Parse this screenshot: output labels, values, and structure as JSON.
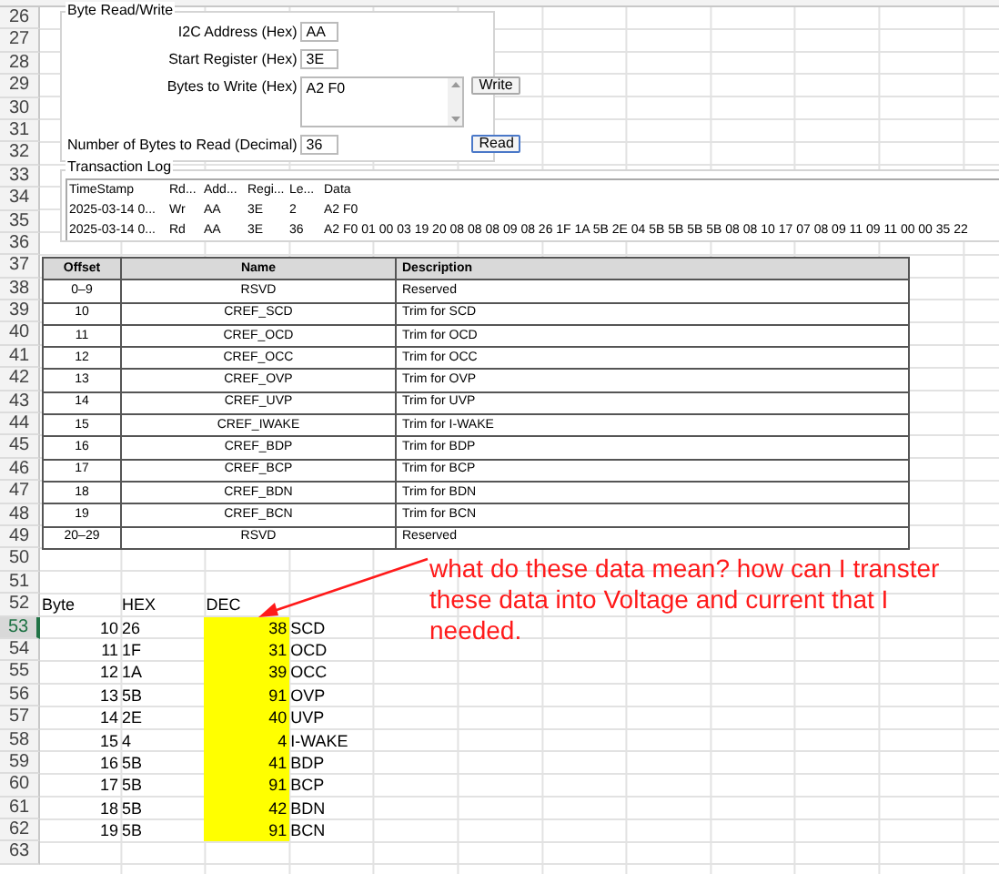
{
  "row_headers": [
    {
      "label": "26",
      "selected": false
    },
    {
      "label": "27",
      "selected": false
    },
    {
      "label": "28",
      "selected": false
    },
    {
      "label": "29",
      "selected": false
    },
    {
      "label": "30",
      "selected": false
    },
    {
      "label": "31",
      "selected": false
    },
    {
      "label": "32",
      "selected": false
    },
    {
      "label": "33",
      "selected": false
    },
    {
      "label": "34",
      "selected": false
    },
    {
      "label": "35",
      "selected": false
    },
    {
      "label": "36",
      "selected": false
    },
    {
      "label": "37",
      "selected": false
    },
    {
      "label": "38",
      "selected": false
    },
    {
      "label": "39",
      "selected": false
    },
    {
      "label": "40",
      "selected": false
    },
    {
      "label": "41",
      "selected": false
    },
    {
      "label": "42",
      "selected": false
    },
    {
      "label": "43",
      "selected": false
    },
    {
      "label": "44",
      "selected": false
    },
    {
      "label": "45",
      "selected": false
    },
    {
      "label": "46",
      "selected": false
    },
    {
      "label": "47",
      "selected": false
    },
    {
      "label": "48",
      "selected": false
    },
    {
      "label": "49",
      "selected": false
    },
    {
      "label": "50",
      "selected": false
    },
    {
      "label": "51",
      "selected": false
    },
    {
      "label": "52",
      "selected": false
    },
    {
      "label": "53",
      "selected": true
    },
    {
      "label": "54",
      "selected": false
    },
    {
      "label": "55",
      "selected": false
    },
    {
      "label": "56",
      "selected": false
    },
    {
      "label": "57",
      "selected": false
    },
    {
      "label": "58",
      "selected": false
    },
    {
      "label": "59",
      "selected": false
    },
    {
      "label": "60",
      "selected": false
    },
    {
      "label": "61",
      "selected": false
    },
    {
      "label": "62",
      "selected": false
    },
    {
      "label": "63",
      "selected": false
    }
  ],
  "read_write_panel": {
    "title": "Byte Read/Write",
    "i2c_address": {
      "label": "I2C Address (Hex)",
      "value": "AA"
    },
    "start_register": {
      "label": "Start Register (Hex)",
      "value": "3E"
    },
    "bytes_to_write": {
      "label": "Bytes to Write (Hex)",
      "value": "A2 F0"
    },
    "write_button": "Write",
    "bytes_to_read": {
      "label": "Number of Bytes to Read (Decimal)",
      "value": "36"
    },
    "read_button": "Read"
  },
  "transaction_log": {
    "title": "Transaction Log",
    "columns": [
      "TimeStamp",
      "Rd...",
      "Add...",
      "Regi...",
      "Le...",
      "Data"
    ],
    "rows": [
      [
        "2025-03-14 0...",
        "Wr",
        "AA",
        "3E",
        "2",
        "A2 F0"
      ],
      [
        "2025-03-14 0...",
        "Rd",
        "AA",
        "3E",
        "36",
        "A2 F0 01 00 03 19 20 08 08 08 09 08 26 1F 1A 5B 2E 04 5B 5B 5B 5B 08 08 10 17 07 08 09 11 09 11 00 00 35 22"
      ]
    ]
  },
  "register_table": {
    "columns": [
      "Offset",
      "Name",
      "Description"
    ],
    "rows": [
      [
        "0–9",
        "RSVD",
        "Reserved"
      ],
      [
        "10",
        "CREF_SCD",
        "Trim for SCD"
      ],
      [
        "11",
        "CREF_OCD",
        "Trim for OCD"
      ],
      [
        "12",
        "CREF_OCC",
        "Trim for OCC"
      ],
      [
        "13",
        "CREF_OVP",
        "Trim for OVP"
      ],
      [
        "14",
        "CREF_UVP",
        "Trim for UVP"
      ],
      [
        "15",
        "CREF_IWAKE",
        "Trim for I-WAKE"
      ],
      [
        "16",
        "CREF_BDP",
        "Trim for BDP"
      ],
      [
        "17",
        "CREF_BCP",
        "Trim for BCP"
      ],
      [
        "18",
        "CREF_BDN",
        "Trim for BDN"
      ],
      [
        "19",
        "CREF_BCN",
        "Trim for BCN"
      ],
      [
        "20–29",
        "RSVD",
        "Reserved"
      ]
    ]
  },
  "sheet_cells": {
    "header": [
      "Byte",
      "HEX",
      "DEC"
    ],
    "rows": [
      {
        "byte": "10",
        "hex": "26",
        "dec": "38",
        "name": "SCD",
        "highlighted": true
      },
      {
        "byte": "11",
        "hex": "1F",
        "dec": "31",
        "name": "OCD",
        "highlighted": true
      },
      {
        "byte": "12",
        "hex": "1A",
        "dec": "39",
        "name": "OCC",
        "highlighted": true
      },
      {
        "byte": "13",
        "hex": "5B",
        "dec": "91",
        "name": "OVP",
        "highlighted": true
      },
      {
        "byte": "14",
        "hex": "2E",
        "dec": "40",
        "name": "UVP",
        "highlighted": true
      },
      {
        "byte": "15",
        "hex": "4",
        "dec": "4",
        "name": "I-WAKE",
        "highlighted": true
      },
      {
        "byte": "16",
        "hex": "5B",
        "dec": "41",
        "name": "BDP",
        "highlighted": true
      },
      {
        "byte": "17",
        "hex": "5B",
        "dec": "91",
        "name": "BCP",
        "highlighted": true
      },
      {
        "byte": "18",
        "hex": "5B",
        "dec": "42",
        "name": "BDN",
        "highlighted": true
      },
      {
        "byte": "19",
        "hex": "5B",
        "dec": "91",
        "name": "BCN",
        "highlighted": true
      }
    ]
  },
  "annotation": "what do these data mean? how can I transter these data into Voltage and current that I needed."
}
